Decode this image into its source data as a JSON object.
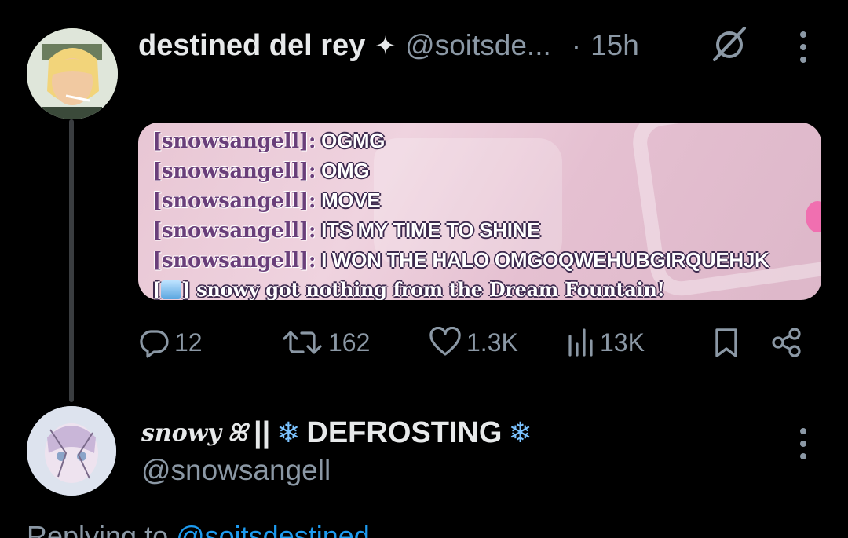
{
  "tweet": {
    "display_name": "destined del rey",
    "badge_icon": "sparkle-icon",
    "handle": "@soitsde...",
    "separator": "·",
    "time": "15h",
    "media": {
      "chat_lines": [
        {
          "user": "[snowsangell]:",
          "message": "OGMG"
        },
        {
          "user": "[snowsangell]:",
          "message": "OMG"
        },
        {
          "user": "[snowsangell]:",
          "message": "MOVE"
        },
        {
          "user": "[snowsangell]:",
          "message": "ITS MY TIME TO SHINE"
        },
        {
          "user": "[snowsangell]:",
          "message": "I WON THE HALO OMGOQWEHUBGIRQUEHJK"
        }
      ],
      "system_line_open": "[",
      "system_line_text": "] snowy got nothing from the Dream Fountain!"
    },
    "stats": {
      "replies": "12",
      "reposts": "162",
      "likes": "1.3K",
      "views": "13K"
    }
  },
  "reply": {
    "script_name": "snowy",
    "script_suffix": "ꕤ",
    "title_sep": "||",
    "snow_left": "❄",
    "title": "DEFROSTING",
    "snow_right": "❄",
    "handle": "@snowsangell",
    "replying_prefix": "Replying to ",
    "replying_to": "@soitsdestined"
  },
  "colors": {
    "background": "#000000",
    "secondary_text": "#8b98a5",
    "link": "#1d9bf0"
  }
}
